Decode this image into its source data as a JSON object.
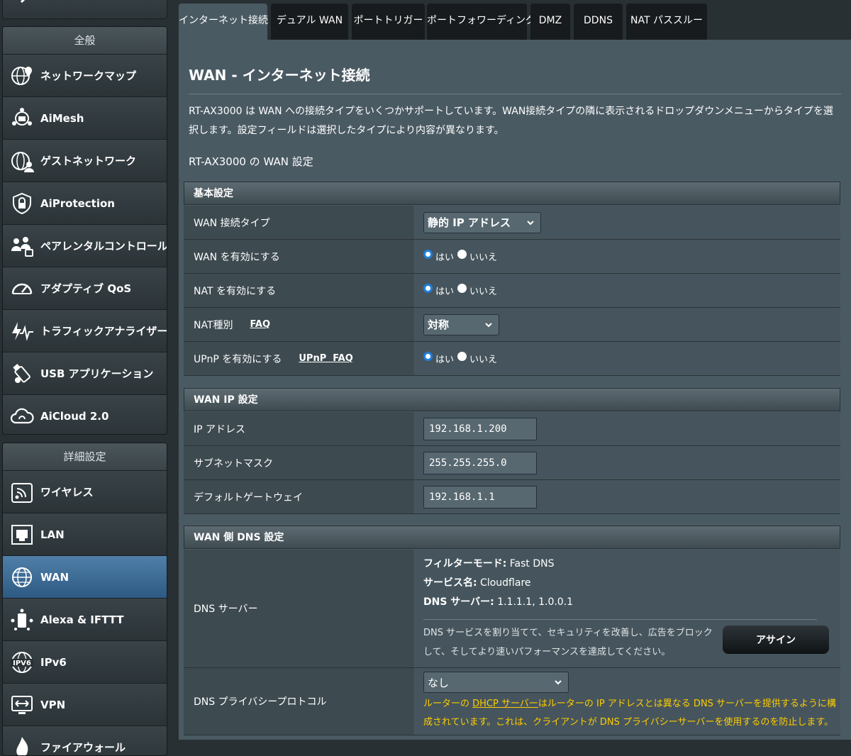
{
  "sidebar": {
    "general_header": "全般",
    "general_items": [
      {
        "label": "ネットワークマップ",
        "icon": "network-map-icon"
      },
      {
        "label": "AiMesh",
        "icon": "aimesh-icon"
      },
      {
        "label": "ゲストネットワーク",
        "icon": "guest-network-icon"
      },
      {
        "label": "AiProtection",
        "icon": "aiprotection-icon"
      },
      {
        "label": "ペアレンタルコントロール",
        "icon": "parental-control-icon"
      },
      {
        "label": "アダプティブ QoS",
        "icon": "qos-gauge-icon"
      },
      {
        "label": "トラフィックアナライザー",
        "icon": "traffic-analyzer-icon"
      },
      {
        "label": "USB アプリケーション",
        "icon": "usb-icon"
      },
      {
        "label": "AiCloud 2.0",
        "icon": "cloud-icon"
      }
    ],
    "advanced_header": "詳細設定",
    "advanced_items": [
      {
        "label": "ワイヤレス",
        "icon": "wireless-icon"
      },
      {
        "label": "LAN",
        "icon": "lan-icon"
      },
      {
        "label": "WAN",
        "icon": "globe-icon"
      },
      {
        "label": "Alexa & IFTTT",
        "icon": "alexa-icon"
      },
      {
        "label": "IPv6",
        "icon": "ipv6-icon"
      },
      {
        "label": "VPN",
        "icon": "vpn-icon"
      },
      {
        "label": "ファイアウォール",
        "icon": "firewall-icon"
      }
    ]
  },
  "tabs": [
    "インターネット接続",
    "デュアル WAN",
    "ポートトリガー",
    "ポートフォワーディング",
    "DMZ",
    "DDNS",
    "NAT パススルー"
  ],
  "page": {
    "title": "WAN - インターネット接続",
    "description": "RT-AX3000 は WAN への接続タイプをいくつかサポートしています。WAN接続タイプの隣に表示されるドロップダウンメニューからタイプを選択します。設定フィールドは選択したタイプにより内容が異なります。",
    "subtitle": "RT-AX3000 の WAN 設定"
  },
  "basic": {
    "header": "基本設定",
    "wan_type_label": "WAN 接続タイプ",
    "wan_type_value": "静的 IP アドレス",
    "enable_wan_label": "WAN を有効にする",
    "enable_nat_label": "NAT を有効にする",
    "nat_type_label": "NAT種別",
    "nat_faq": "FAQ",
    "nat_type_value": "対称",
    "upnp_label": "UPnP を有効にする",
    "upnp_faq": "UPnP  FAQ",
    "yes": "はい",
    "no": "いいえ"
  },
  "wanip": {
    "header": "WAN IP 設定",
    "ip_label": "IP アドレス",
    "ip_value": "192.168.1.200",
    "mask_label": "サブネットマスク",
    "mask_value": "255.255.255.0",
    "gateway_label": "デフォルトゲートウェイ",
    "gateway_value": "192.168.1.1"
  },
  "dns": {
    "header": "WAN 側 DNS 設定",
    "server_label": "DNS サーバー",
    "filter_key": "フィルターモード:",
    "filter_value": " Fast DNS",
    "service_key": "サービス名:",
    "service_value": " Cloudflare",
    "server_key": "DNS サーバー:",
    "server_value": " 1.1.1.1, 1.0.0.1",
    "note": "DNS サービスを割り当てて、セキュリティを改善し、広告をブロックして、そしてより速いパフォーマンスを達成してください。",
    "assign_button": "アサイン",
    "privacy_label": "DNS プライバシープロトコル",
    "privacy_value": "なし",
    "warning_pre": "ルーターの ",
    "warning_link": "DHCP サーバー",
    "warning_post": "はルーターの IP アドレスとは異なる DNS サーバーを提供するように構成されています。これは、クライアントが DNS プライバシーサーバーを使用するのを防止します。"
  },
  "colors": {
    "background": "#283034",
    "panel": "#4a5a63",
    "active_nav": "#2d5a83",
    "radio_selected": "#1f7fe0",
    "warning_text": "#ffcc00"
  }
}
